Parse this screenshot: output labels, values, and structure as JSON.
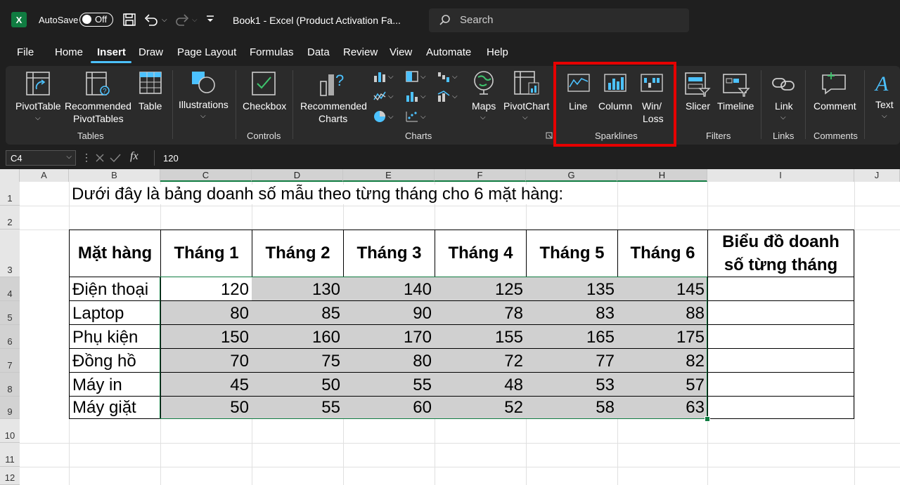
{
  "titlebar": {
    "autosave_label": "AutoSave",
    "autosave_state": "Off",
    "document_title": "Book1  -  Excel (Product Activation Fa...",
    "search_placeholder": "Search"
  },
  "menu": [
    "File",
    "Home",
    "Insert",
    "Draw",
    "Page Layout",
    "Formulas",
    "Data",
    "Review",
    "View",
    "Automate",
    "Help"
  ],
  "menu_active": "Insert",
  "ribbon": {
    "pivottable": "PivotTable",
    "recommended_pivottables_1": "Recommended",
    "recommended_pivottables_2": "PivotTables",
    "table": "Table",
    "group_tables": "Tables",
    "illustrations": "Illustrations",
    "checkbox": "Checkbox",
    "group_controls": "Controls",
    "recommended_charts_1": "Recommended",
    "recommended_charts_2": "Charts",
    "maps": "Maps",
    "pivotchart": "PivotChart",
    "group_charts": "Charts",
    "line": "Line",
    "column": "Column",
    "winloss_1": "Win/",
    "winloss_2": "Loss",
    "group_sparklines": "Sparklines",
    "slicer": "Slicer",
    "timeline": "Timeline",
    "group_filters": "Filters",
    "link": "Link",
    "group_links": "Links",
    "comment": "Comment",
    "group_comments": "Comments",
    "text": "Text"
  },
  "formula_bar": {
    "name_box": "C4",
    "fx_label": "fx",
    "formula": "120"
  },
  "columns": [
    "A",
    "B",
    "C",
    "D",
    "E",
    "F",
    "G",
    "H",
    "I",
    "J"
  ],
  "rows": [
    "1",
    "2",
    "3",
    "4",
    "5",
    "6",
    "7",
    "8",
    "9",
    "10",
    "11",
    "12"
  ],
  "sheet": {
    "intro_text": "Dưới đây là bảng doanh số mẫu theo từng tháng cho 6 mặt hàng:",
    "header_product": "Mặt hàng",
    "months": [
      "Tháng 1",
      "Tháng 2",
      "Tháng 3",
      "Tháng 4",
      "Tháng 5",
      "Tháng 6"
    ],
    "chart_header_1": "Biểu đồ doanh",
    "chart_header_2": "số từng tháng",
    "products": [
      {
        "name": "Điện thoại",
        "values": [
          "120",
          "130",
          "140",
          "125",
          "135",
          "145"
        ]
      },
      {
        "name": "Laptop",
        "values": [
          "80",
          "85",
          "90",
          "78",
          "83",
          "88"
        ]
      },
      {
        "name": "Phụ kiện",
        "values": [
          "150",
          "160",
          "170",
          "155",
          "165",
          "175"
        ]
      },
      {
        "name": "Đồng hồ",
        "values": [
          "70",
          "75",
          "80",
          "72",
          "77",
          "82"
        ]
      },
      {
        "name": "Máy in",
        "values": [
          "45",
          "50",
          "55",
          "48",
          "53",
          "57"
        ]
      },
      {
        "name": "Máy giặt",
        "values": [
          "50",
          "55",
          "60",
          "52",
          "58",
          "63"
        ]
      }
    ]
  },
  "colors": {
    "excel_green": "#107c41",
    "highlight_red": "#e60000",
    "selection_fill": "#d0d0d0"
  }
}
